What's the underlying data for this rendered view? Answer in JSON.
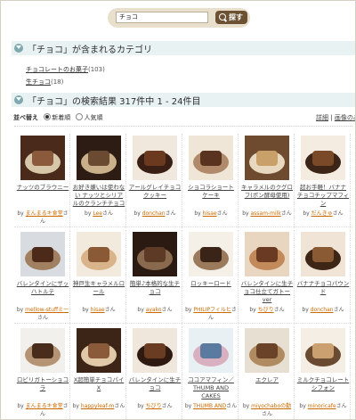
{
  "search": {
    "value": "チョコ",
    "button_label": "探す"
  },
  "categories_section": {
    "title": "「チョコ」が含まれるカテゴリ"
  },
  "categories": [
    {
      "name": "チョコレートのお菓子",
      "count": "(103)"
    },
    {
      "name": "生チョコ",
      "count": "(18)"
    }
  ],
  "results_section": {
    "title": "「チョコ」の検索結果 317件中 1 - 24件目"
  },
  "sort": {
    "label": "並べ替え",
    "options": [
      "新着順",
      "人気順"
    ],
    "selected": "新着順"
  },
  "view_links": {
    "detail": "詳細",
    "sep": "|",
    "image": "画像のみ"
  },
  "suffix": "さん",
  "by_prefix": "by",
  "recipes": [
    {
      "title": "ナッツのブラウニー",
      "author": "まんまるキ食堂"
    },
    {
      "title": "お好き嫌いは使わない ナッツとシリアルのクランチチョコ",
      "author": "Lee"
    },
    {
      "title": "アールグレイチョコクッキー",
      "author": "donchan"
    },
    {
      "title": "ショコラショート ケーキ",
      "author": "hisae"
    },
    {
      "title": "キャラメルのクグロフ(ポン酵母使用)",
      "author": "assam-milk"
    },
    {
      "title": "超お手軽！バナナ チョコチップマフィン",
      "author": "だんきゅ"
    },
    {
      "title": "バレンタインにザッハトルテ",
      "author": "mellow-stuffミー"
    },
    {
      "title": "神戸生キャラメルロール",
      "author": "hisae"
    },
    {
      "title": "簡単♪本格的な生チョコ",
      "author": "ayako"
    },
    {
      "title": "ロッキーロード",
      "author": "PHILIPフィルヒ"
    },
    {
      "title": "バレンタインに生チョコ仕立てガトーver",
      "author": "ちびり"
    },
    {
      "title": "バナナチョコパウンド",
      "author": "donchan"
    },
    {
      "title": "ロビリガトーショコラ",
      "author": "まんまるキ食堂"
    },
    {
      "title": "X超簡単チョコパイX",
      "author": "happyleaf-m"
    },
    {
      "title": "バレンタインに生チョコ",
      "author": "ちびり"
    },
    {
      "title": "ココアマフィン／THUMB AND CAKES",
      "author": "THUMB AND"
    },
    {
      "title": "エクレア",
      "author": "miyochaboの勤"
    },
    {
      "title": "ミルクチョコレートシフォン",
      "author": "minoricafe"
    }
  ],
  "colors": {
    "accent": "#cc6a00",
    "section_bg": "#e9f2f3",
    "search_bg": "#e8dfcc",
    "button": "#6d5133"
  }
}
